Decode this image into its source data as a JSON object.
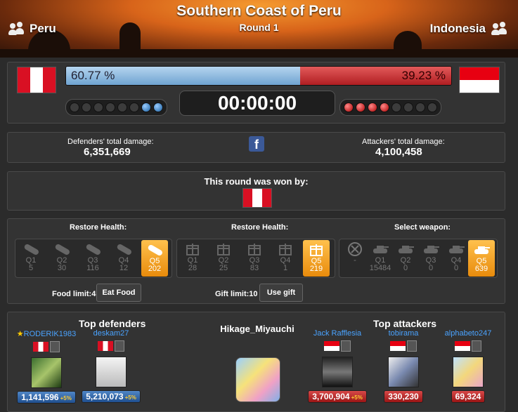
{
  "header": {
    "title": "Southern Coast of Peru",
    "round": "Round 1",
    "defender_country": "Peru",
    "attacker_country": "Indonesia",
    "left_icon": "people-icon",
    "right_icon": "people-icon"
  },
  "domination": {
    "defender_percent": "60.77 %",
    "attacker_percent": "39.23 %",
    "defender_share": 0.6077,
    "timer": "00:00:00",
    "defender_rounds_won": 2,
    "attacker_rounds_won": 4,
    "total_slots": 8
  },
  "damage": {
    "defenders_label": "Defenders' total damage:",
    "defenders_value": "6,351,669",
    "attackers_label": "Attackers' total damage:",
    "attackers_value": "4,100,458",
    "share_icon": "facebook-icon"
  },
  "winner": {
    "text": "This round was won by:",
    "flag": "Peru"
  },
  "restore_food": {
    "title": "Restore Health:",
    "items": [
      {
        "q": "Q1",
        "n": "5"
      },
      {
        "q": "Q2",
        "n": "30"
      },
      {
        "q": "Q3",
        "n": "116"
      },
      {
        "q": "Q4",
        "n": "12"
      },
      {
        "q": "Q5",
        "n": "202"
      }
    ],
    "limit": "Food limit:4",
    "button": "Eat Food"
  },
  "restore_gift": {
    "title": "Restore Health:",
    "items": [
      {
        "q": "Q1",
        "n": "28"
      },
      {
        "q": "Q2",
        "n": "25"
      },
      {
        "q": "Q3",
        "n": "83"
      },
      {
        "q": "Q4",
        "n": "1"
      },
      {
        "q": "Q5",
        "n": "219"
      }
    ],
    "limit": "Gift limit:10",
    "button": "Use gift"
  },
  "weapons": {
    "title": "Select weapon:",
    "items": [
      {
        "q": "",
        "n": "-"
      },
      {
        "q": "Q1",
        "n": "15484"
      },
      {
        "q": "Q2",
        "n": "0"
      },
      {
        "q": "Q3",
        "n": "0"
      },
      {
        "q": "Q4",
        "n": "0"
      },
      {
        "q": "Q5",
        "n": "639"
      }
    ]
  },
  "tops": {
    "defenders_title": "Top defenders",
    "attackers_title": "Top attackers",
    "player_name": "Hikage_Miyauchi",
    "defenders": [
      {
        "name": "RODERIK1983",
        "damage": "1,141,596",
        "bonus": "+5%"
      },
      {
        "name": "deskam27",
        "damage": "5,210,073",
        "bonus": "+5%"
      }
    ],
    "attackers": [
      {
        "name": "Jack Rafflesia",
        "damage": "3,700,904",
        "bonus": "+5%"
      },
      {
        "name": "tobirama",
        "damage": "330,230",
        "bonus": ""
      },
      {
        "name": "alphabeto247",
        "damage": "69,324",
        "bonus": ""
      }
    ]
  }
}
